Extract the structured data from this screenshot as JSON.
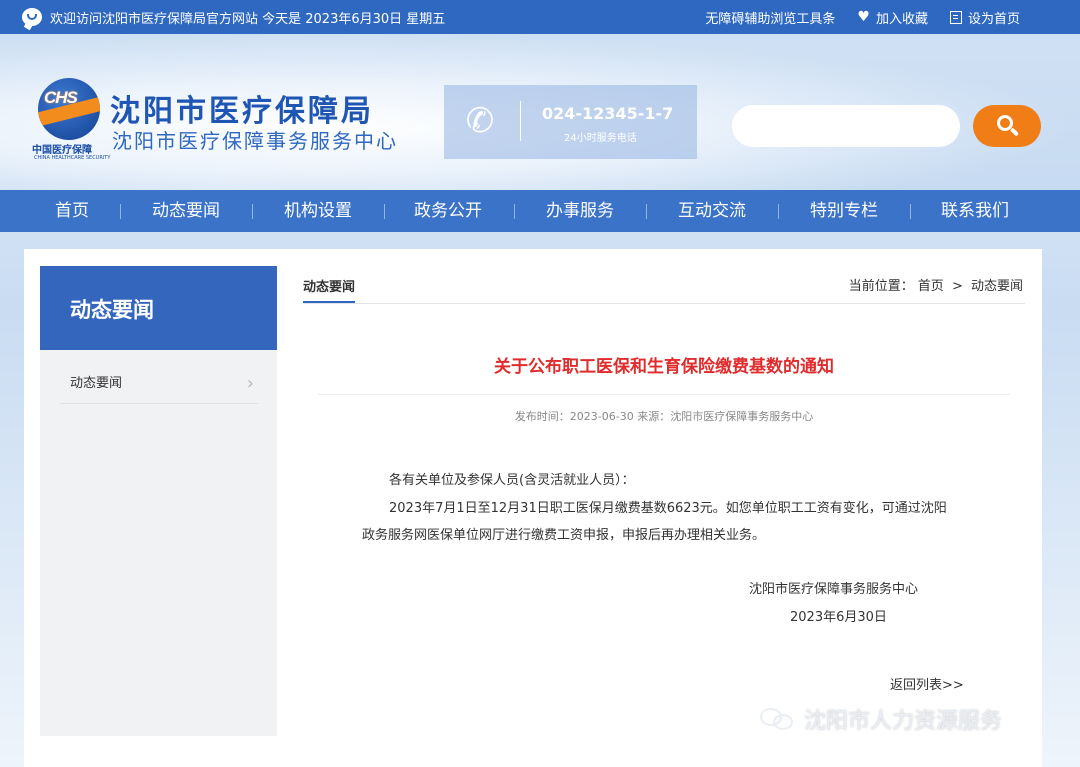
{
  "topbar": {
    "welcome": "欢迎访问沈阳市医疗保障局官方网站 今天是 2023年6月30日 星期五",
    "accessibility": "无障碍辅助浏览工具条",
    "favorite": "加入收藏",
    "set_home": "设为首页"
  },
  "header": {
    "logo_cn": "中国医疗保障",
    "logo_en": "CHINA HEALTHCARE SECURITY",
    "logo_mark": "CHS",
    "title": "沈阳市医疗保障局",
    "subtitle": "沈阳市医疗保障事务服务中心",
    "phone_number": "024-12345-1-7",
    "phone_desc": "24小时服务电话",
    "search_placeholder": ""
  },
  "nav": {
    "items": [
      "首页",
      "动态要闻",
      "机构设置",
      "政务公开",
      "办事服务",
      "互动交流",
      "特别专栏",
      "联系我们"
    ]
  },
  "sidebar": {
    "heading": "动态要闻",
    "items": [
      {
        "label": "动态要闻"
      }
    ]
  },
  "content": {
    "tab": "动态要闻",
    "breadcrumb_prefix": "当前位置：",
    "breadcrumb": [
      "首页",
      "动态要闻"
    ],
    "breadcrumb_sep": ">",
    "title": "关于公布职工医保和生育保险缴费基数的通知",
    "meta": "发布时间：2023-06-30 来源：沈阳市医疗保障事务服务中心",
    "salutation": "各有关单位及参保人员(含灵活就业人员）：",
    "body_line1": "2023年7月1日至12月31日职工医保月缴费基数6623元。如您单位职工工资有变化，可通过沈阳",
    "body_line2": "政务服务网医保单位网厅进行缴费工资申报，申报后再办理相关业务。",
    "signature_org": "沈阳市医疗保障事务服务中心",
    "signature_date": "2023年6月30日",
    "back_link": "返回列表>>"
  },
  "watermark": {
    "text": "沈阳市人力资源服务"
  },
  "colors": {
    "brand_blue": "#2e68c0",
    "nav_blue": "#3a73c7",
    "accent_orange": "#f07d16",
    "title_red": "#e02c2c"
  }
}
